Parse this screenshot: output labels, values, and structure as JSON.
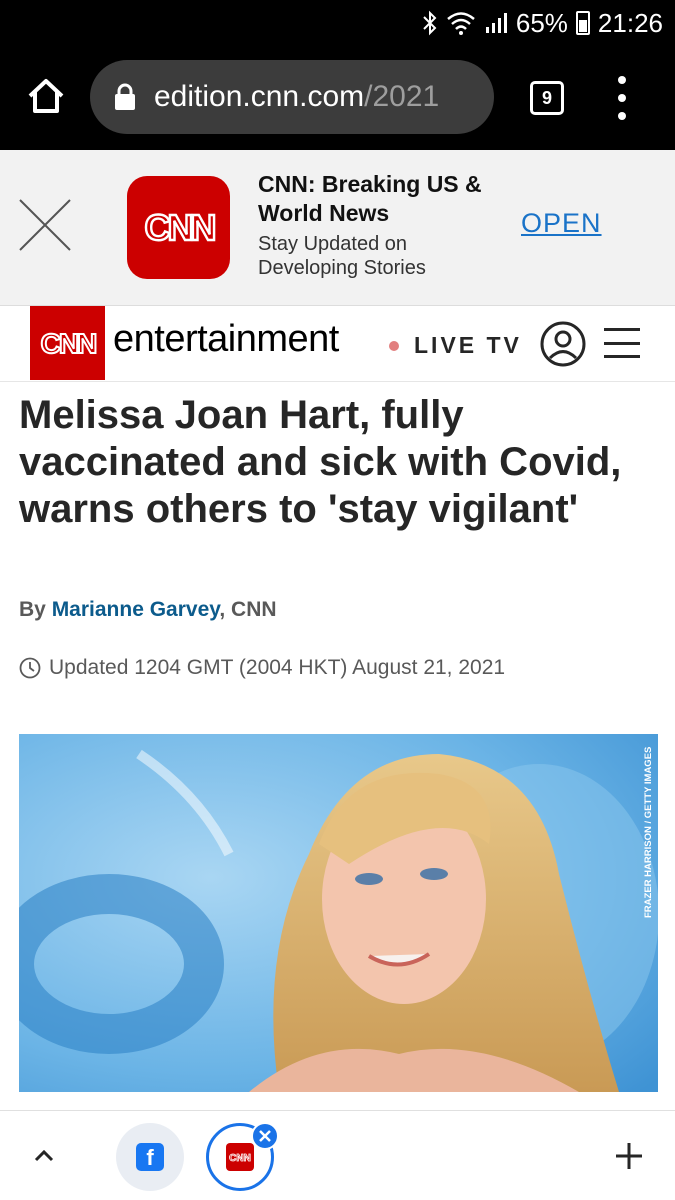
{
  "status_bar": {
    "battery": "65%",
    "time": "21:26"
  },
  "browser": {
    "url_host": "edition.cnn.com",
    "url_path": "/2021",
    "tab_count": "9"
  },
  "app_banner": {
    "title": "CNN: Breaking US & World News",
    "subtitle": "Stay Updated on Developing Stories",
    "open_label": "OPEN",
    "logo_text": "CNN"
  },
  "nav": {
    "logo_text": "CNN",
    "section": "entertainment",
    "live_tv": "LIVE TV"
  },
  "article": {
    "headline": "Melissa Joan Hart, fully vaccinated and sick with Covid, warns others to 'stay vigilant'",
    "byline_prefix": "By ",
    "author": "Marianne Garvey",
    "byline_suffix": ", CNN",
    "updated": "Updated 1204 GMT (2004 HKT) August 21, 2021",
    "photo_credit": "FRAZER HARRISON / GETTY IMAGES"
  },
  "bottom_bar": {
    "fb_letter": "f",
    "cnn_mini": "CNN"
  },
  "colors": {
    "cnn_red": "#cc0000",
    "link_blue": "#1a73c8",
    "author_blue": "#0c5b8c"
  }
}
